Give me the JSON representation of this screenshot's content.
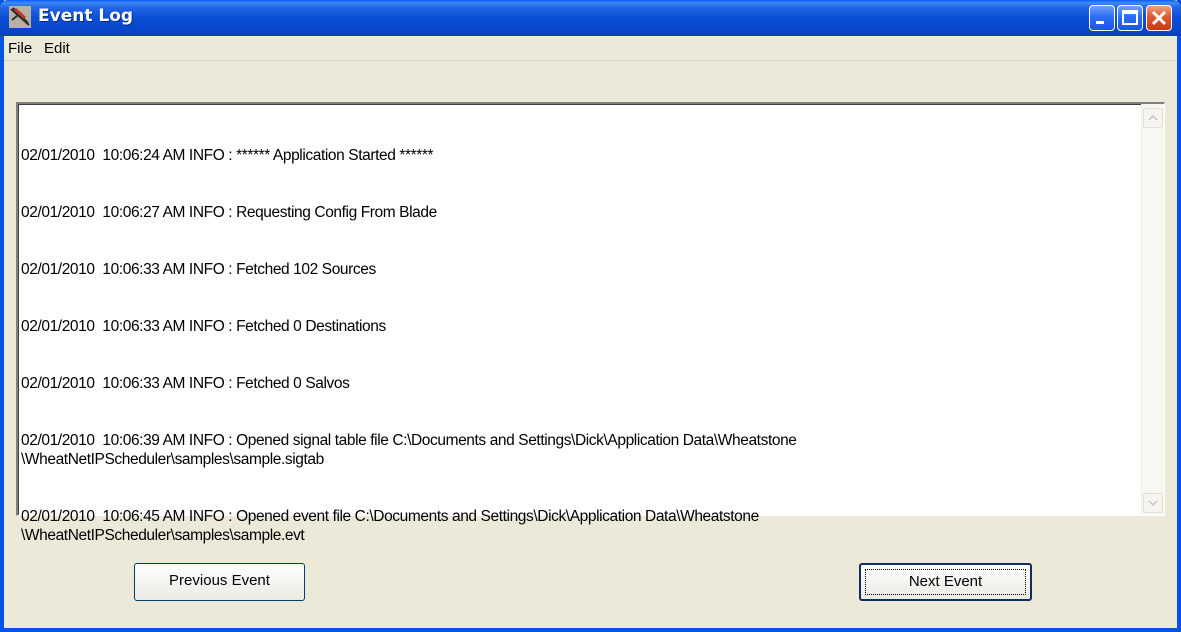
{
  "window": {
    "title": "Event Log",
    "icon": "event-log-app-icon",
    "controls": [
      "minimize-icon",
      "maximize-icon",
      "close-icon"
    ]
  },
  "menu": {
    "items": [
      {
        "label": "File"
      },
      {
        "label": "Edit"
      }
    ]
  },
  "log": {
    "lines": [
      "02/01/2010  10:06:24 AM INFO : ****** Application Started ******",
      "02/01/2010  10:06:27 AM INFO : Requesting Config From Blade",
      "02/01/2010  10:06:33 AM INFO : Fetched 102 Sources",
      "02/01/2010  10:06:33 AM INFO : Fetched 0 Destinations",
      "02/01/2010  10:06:33 AM INFO : Fetched 0 Salvos",
      "02/01/2010  10:06:39 AM INFO : Opened signal table file C:\\Documents and Settings\\Dick\\Application Data\\Wheatstone\n\\WheatNetIPScheduler\\samples\\sample.sigtab",
      "02/01/2010  10:06:45 AM INFO : Opened event file C:\\Documents and Settings\\Dick\\Application Data\\Wheatstone\n\\WheatNetIPScheduler\\samples\\sample.evt"
    ]
  },
  "buttons": {
    "previous": "Previous Event",
    "next": "Next Event"
  },
  "colors": {
    "titlebar": "#0a4fd6",
    "close": "#e05a2a",
    "face": "#ece9d8"
  }
}
